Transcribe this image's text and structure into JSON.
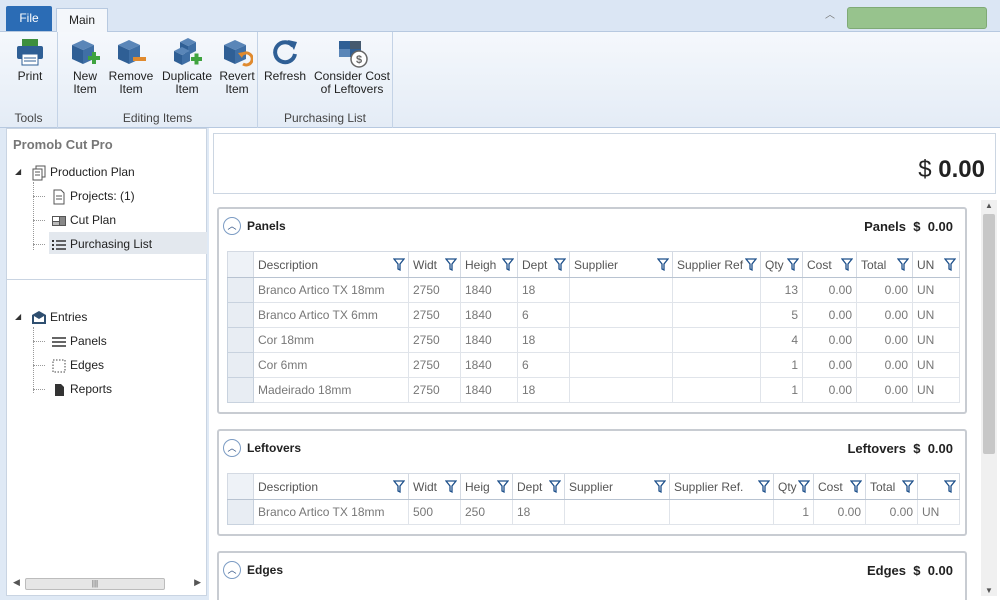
{
  "tabs": {
    "file": "File",
    "main": "Main"
  },
  "ribbon": {
    "tools": {
      "label": "Tools",
      "print": "Print"
    },
    "editing": {
      "label": "Editing Items",
      "new_item": [
        "New",
        "Item"
      ],
      "remove_item": [
        "Remove",
        "Item"
      ],
      "duplicate_item": [
        "Duplicate",
        "Item"
      ],
      "revert_item": [
        "Revert",
        "Item"
      ]
    },
    "purchasing": {
      "label": "Purchasing List",
      "refresh": "Refresh",
      "consider_cost": [
        "Consider Cost",
        "of Leftovers"
      ]
    }
  },
  "sidebar": {
    "title": "Promob Cut Pro",
    "production_plan": "Production Plan",
    "projects": "Projects: (1)",
    "cut_plan": "Cut Plan",
    "purchasing_list": "Purchasing List",
    "entries": "Entries",
    "panels": "Panels",
    "edges": "Edges",
    "reports": "Reports"
  },
  "total": {
    "currency": "$",
    "value": "0.00"
  },
  "panels": {
    "title": "Panels",
    "total_label": "Panels",
    "currency": "$",
    "total": "0.00",
    "columns": [
      "Description",
      "Widt",
      "Heigh",
      "Dept",
      "Supplier",
      "Supplier Ref",
      "Qty",
      "Cost",
      "Total",
      "UN"
    ],
    "rows": [
      [
        "Branco Artico TX 18mm",
        "2750",
        "1840",
        "18",
        "",
        "",
        "13",
        "0.00",
        "0.00",
        "UN"
      ],
      [
        "Branco Artico TX 6mm",
        "2750",
        "1840",
        "6",
        "",
        "",
        "5",
        "0.00",
        "0.00",
        "UN"
      ],
      [
        "Cor 18mm",
        "2750",
        "1840",
        "18",
        "",
        "",
        "4",
        "0.00",
        "0.00",
        "UN"
      ],
      [
        "Cor 6mm",
        "2750",
        "1840",
        "6",
        "",
        "",
        "1",
        "0.00",
        "0.00",
        "UN"
      ],
      [
        "Madeirado 18mm",
        "2750",
        "1840",
        "18",
        "",
        "",
        "1",
        "0.00",
        "0.00",
        "UN"
      ]
    ]
  },
  "leftovers": {
    "title": "Leftovers",
    "total_label": "Leftovers",
    "currency": "$",
    "total": "0.00",
    "columns": [
      "Description",
      "Widt",
      "Heig",
      "Dept",
      "Supplier",
      "Supplier Ref.",
      "Qty",
      "Cost",
      "Total",
      ""
    ],
    "rows": [
      [
        "Branco Artico TX 18mm",
        "500",
        "250",
        "18",
        "",
        "",
        "1",
        "0.00",
        "0.00",
        "UN"
      ]
    ]
  },
  "edges": {
    "title": "Edges",
    "total_label": "Edges",
    "currency": "$",
    "total": "0.00"
  }
}
